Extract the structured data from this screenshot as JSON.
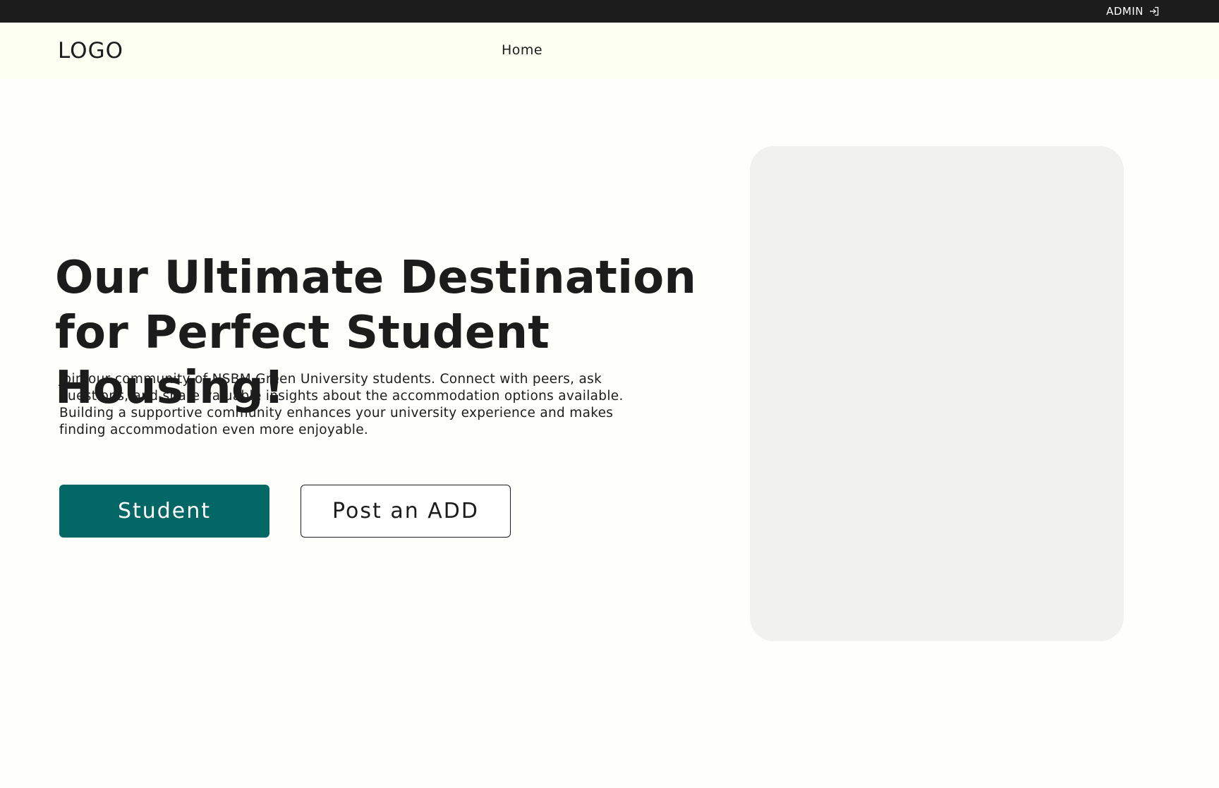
{
  "topbar": {
    "admin_label": "ADMIN",
    "admin_icon": "login-icon",
    "background": "#1c1c1c"
  },
  "navbar": {
    "logo": "LOGO",
    "links": [
      {
        "label": "Home"
      }
    ],
    "background": "#fbfef0"
  },
  "hero": {
    "title_line1": "Our Ultimate Destination",
    "title_line2": "for Perfect Student Housing!",
    "description": "Join our community of NSBM Green University students. Connect with peers, ask questions, and share valuable insights about the accommodation options available. Building a supportive community enhances your university experience and makes finding accommodation even more enjoyable.",
    "primary_button": "Student",
    "secondary_button": "Post an ADD",
    "primary_color": "#036865",
    "image_placeholder_color": "#f1f1f0"
  }
}
